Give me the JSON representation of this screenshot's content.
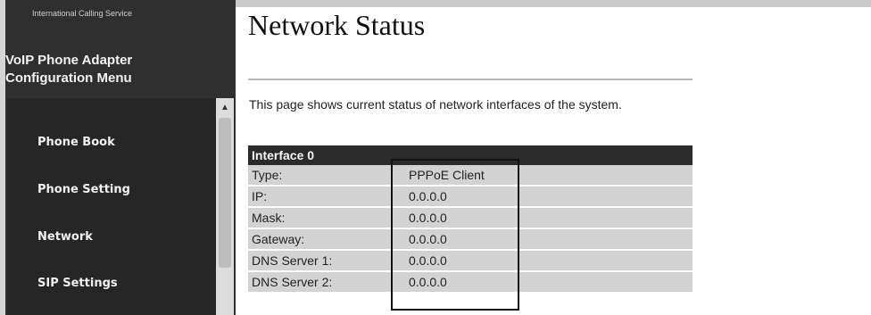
{
  "sidebar": {
    "tagline": "International Calling Service",
    "title_line1": "VoIP Phone Adapter",
    "title_line2": "Configuration Menu",
    "items": [
      {
        "label": "Phone Book"
      },
      {
        "label": "Phone Setting"
      },
      {
        "label": "Network"
      },
      {
        "label": "SIP Settings"
      }
    ]
  },
  "main": {
    "title": "Network Status",
    "description": "This page shows current status of network interfaces of the system.",
    "table": {
      "header": "Interface 0",
      "rows": [
        {
          "label": "Type:",
          "value": "PPPoE Client"
        },
        {
          "label": "IP:",
          "value": "0.0.0.0"
        },
        {
          "label": "Mask:",
          "value": "0.0.0.0"
        },
        {
          "label": "Gateway:",
          "value": "0.0.0.0"
        },
        {
          "label": "DNS Server 1:",
          "value": "0.0.0.0"
        },
        {
          "label": "DNS Server 2:",
          "value": "0.0.0.0"
        }
      ]
    }
  },
  "icons": {
    "scroll_up": "chevron-up-icon"
  }
}
